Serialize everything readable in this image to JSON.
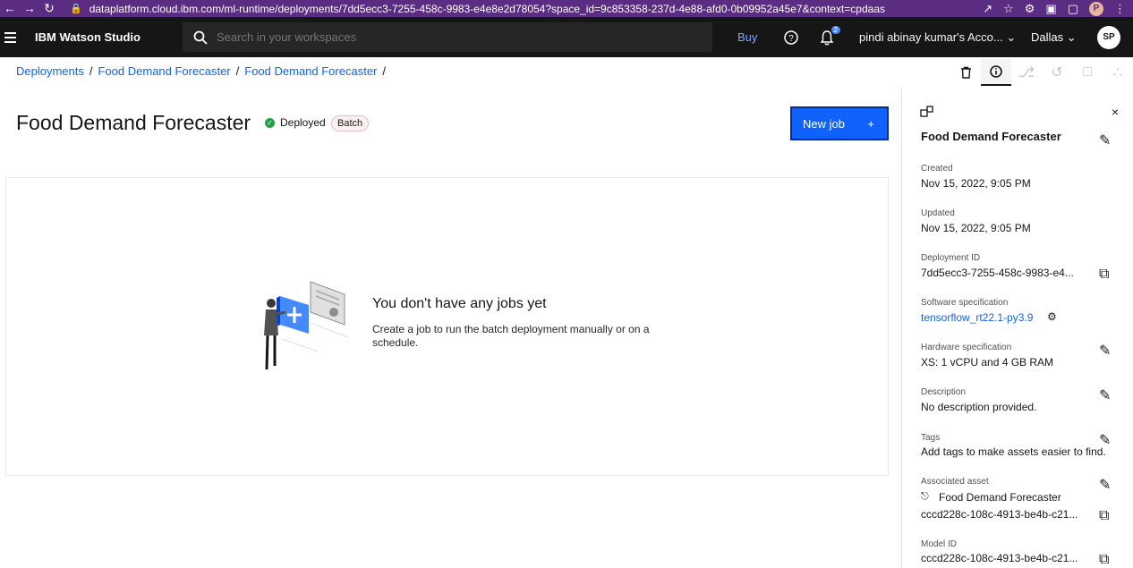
{
  "browser": {
    "url": "dataplatform.cloud.ibm.com/ml-runtime/deployments/7dd5ecc3-7255-458c-9983-e4e8e2d78054?space_id=9c853358-237d-4e88-afd0-0b09952a45e7&context=cpdaas",
    "profile_initial": "P"
  },
  "header": {
    "app_name": "IBM Watson Studio",
    "search_placeholder": "Search in your workspaces",
    "buy_label": "Buy",
    "notification_count": "2",
    "account": "pindi abinay kumar's Acco...",
    "region": "Dallas",
    "user_initials": "SP"
  },
  "breadcrumb": [
    "Deployments",
    "Food Demand Forecaster",
    "Food Demand Forecaster"
  ],
  "page": {
    "title": "Food Demand Forecaster",
    "status": "Deployed",
    "tag": "Batch",
    "new_job_label": "New job",
    "new_job_plus": "+"
  },
  "empty_state": {
    "heading": "You don't have any jobs yet",
    "text": "Create a job to run the batch deployment manually or on a schedule."
  },
  "panel": {
    "title": "Food Demand Forecaster",
    "close": "×",
    "fields": {
      "created_label": "Created",
      "created_value": "Nov 15, 2022, 9:05 PM",
      "updated_label": "Updated",
      "updated_value": "Nov 15, 2022, 9:05 PM",
      "deployment_id_label": "Deployment ID",
      "deployment_id_value": "7dd5ecc3-7255-458c-9983-e4...",
      "software_label": "Software specification",
      "software_value": "tensorflow_rt22.1-py3.9",
      "hardware_label": "Hardware specification",
      "hardware_value": "XS: 1 vCPU and 4 GB RAM",
      "description_label": "Description",
      "description_value": "No description provided.",
      "tags_label": "Tags",
      "tags_value": "Add tags to make assets easier to find.",
      "asset_label": "Associated asset",
      "asset_name": "Food Demand Forecaster",
      "asset_id": "cccd228c-108c-4913-be4b-c21...",
      "model_id_label": "Model ID",
      "model_id_value": "cccd228c-108c-4913-be4b-c21..."
    }
  },
  "colors": {
    "browser_bar": "#5a2d82",
    "header_bg": "#161616",
    "primary": "#0f62fe",
    "success": "#24a148"
  },
  "icons": [
    "back-icon",
    "forward-icon",
    "reload-icon",
    "lock-icon",
    "share-icon",
    "star-icon",
    "extension-icon",
    "search-icon",
    "help-icon",
    "notification-icon",
    "chevron-down-icon",
    "trash-icon",
    "info-icon",
    "close-icon",
    "edit-icon",
    "copy-icon",
    "settings-icon",
    "model-icon"
  ]
}
